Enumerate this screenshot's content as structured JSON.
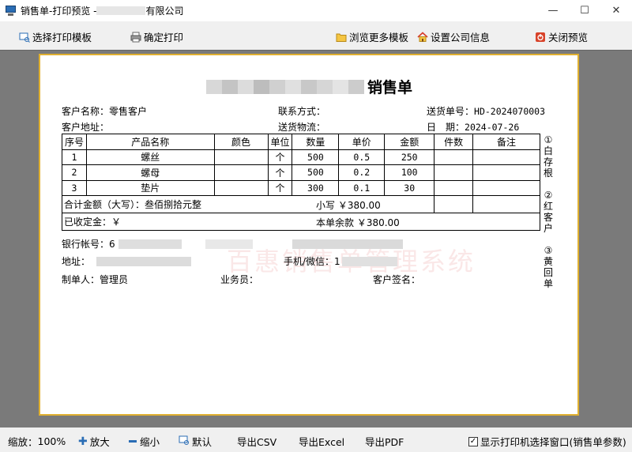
{
  "window": {
    "title_prefix": "销售单-打印预览 - ",
    "title_suffix": "有限公司",
    "minimize": "—",
    "maximize": "☐",
    "close": "✕"
  },
  "toolbar": {
    "select_template": "选择打印模板",
    "confirm_print": "确定打印",
    "browse_templates": "浏览更多模板",
    "company_info": "设置公司信息",
    "close_preview": "关闭预览"
  },
  "document": {
    "title": "销售单",
    "watermark": "百惠销售单管理系统",
    "customer_name_label": "客户名称：",
    "customer_name": "零售客户",
    "contact_label": "联系方式：",
    "delivery_no_label": "送货单号：",
    "delivery_no": "HD-2024070003",
    "address_label": "客户地址：",
    "logistics_label": "送货物流：",
    "date_label": "日　期：",
    "date": "2024-07-26",
    "table": {
      "headers": [
        "序号",
        "产品名称",
        "颜色",
        "单位",
        "数量",
        "单价",
        "金额",
        "件数",
        "备注"
      ],
      "rows": [
        {
          "no": "1",
          "name": "螺丝",
          "color": "",
          "unit": "个",
          "qty": "500",
          "price": "0.5",
          "amount": "250",
          "pieces": "",
          "note": ""
        },
        {
          "no": "2",
          "name": "螺母",
          "color": "",
          "unit": "个",
          "qty": "500",
          "price": "0.2",
          "amount": "100",
          "pieces": "",
          "note": ""
        },
        {
          "no": "3",
          "name": "垫片",
          "color": "",
          "unit": "个",
          "qty": "300",
          "price": "0.1",
          "amount": "30",
          "pieces": "",
          "note": ""
        }
      ],
      "total_upper": "合计金额（大写）：叁佰捌拾元整",
      "total_lower": "小写 ￥380.00",
      "received": "已收定金：￥",
      "balance": "本单余款 ￥380.00"
    },
    "side_notes": [
      "①白存根",
      "②红客户",
      "③黄回单"
    ],
    "bank_label": "银行帐号：6",
    "addr_label": "地址：",
    "phone_label": "手机/微信：1",
    "maker_label": "制单人：",
    "maker": "管理员",
    "salesman_label": "业务员：",
    "customer_sign_label": "客户签名："
  },
  "statusbar": {
    "zoom_label": "缩放：",
    "zoom_value": "100%",
    "zoom_in": "放大",
    "zoom_out": "缩小",
    "default": "默认",
    "export_csv": "导出CSV",
    "export_excel": "导出Excel",
    "export_pdf": "导出PDF",
    "show_printer_dialog": "显示打印机选择窗口(销售单参数)"
  },
  "colors": {
    "page_border": "#e0b030",
    "preview_bg": "#7a7a7a",
    "watermark": "#dc4646"
  }
}
